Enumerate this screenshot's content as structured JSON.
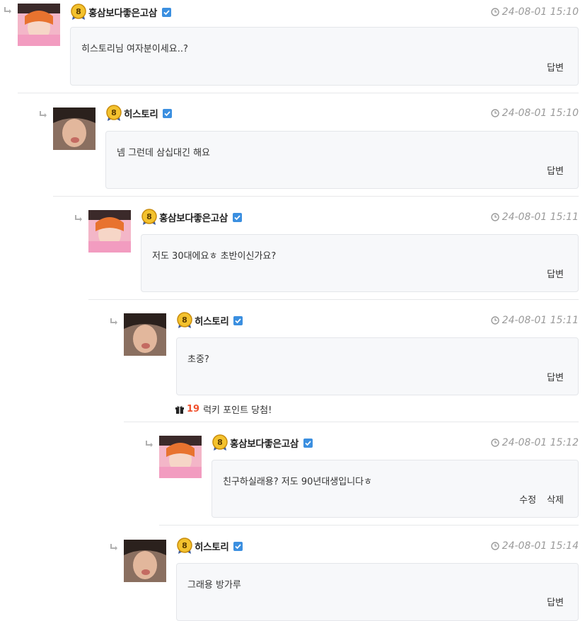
{
  "comments": [
    {
      "author": "홍삼보다좋은고삼",
      "level": "8",
      "date": "24-08-01 15:10",
      "body": "히스토리님 여자분이세요..?",
      "actions": [
        "답변"
      ]
    },
    {
      "author": "히스토리",
      "level": "8",
      "date": "24-08-01 15:10",
      "body": "넴 그런데 삼십대긴 해요",
      "actions": [
        "답변"
      ]
    },
    {
      "author": "홍삼보다좋은고삼",
      "level": "8",
      "date": "24-08-01 15:11",
      "body": "저도 30대에요ㅎ 초반이신가요?",
      "actions": [
        "답변"
      ]
    },
    {
      "author": "히스토리",
      "level": "8",
      "date": "24-08-01 15:11",
      "body": "초중?",
      "actions": [
        "답변"
      ],
      "lucky_points": "19",
      "lucky_text": "럭키 포인트 당첨!"
    },
    {
      "author": "홍삼보다좋은고삼",
      "level": "8",
      "date": "24-08-01 15:12",
      "body": "친구하실래용? 저도 90년대생입니다ㅎ",
      "actions": [
        "수정",
        "삭제"
      ]
    },
    {
      "author": "히스토리",
      "level": "8",
      "date": "24-08-01 15:14",
      "body": "그래용 방가루",
      "actions": [
        "답변"
      ]
    }
  ],
  "icons": {
    "reply": "reply-arrow-icon",
    "verified": "verified-check-icon",
    "clock": "clock-icon",
    "gift": "gift-icon",
    "level": "level-badge-icon"
  },
  "colors": {
    "verified": "#3b8fe0",
    "lucky_number": "#f0522f",
    "date": "#9a9a9a",
    "box_bg": "#f7f8fa"
  }
}
